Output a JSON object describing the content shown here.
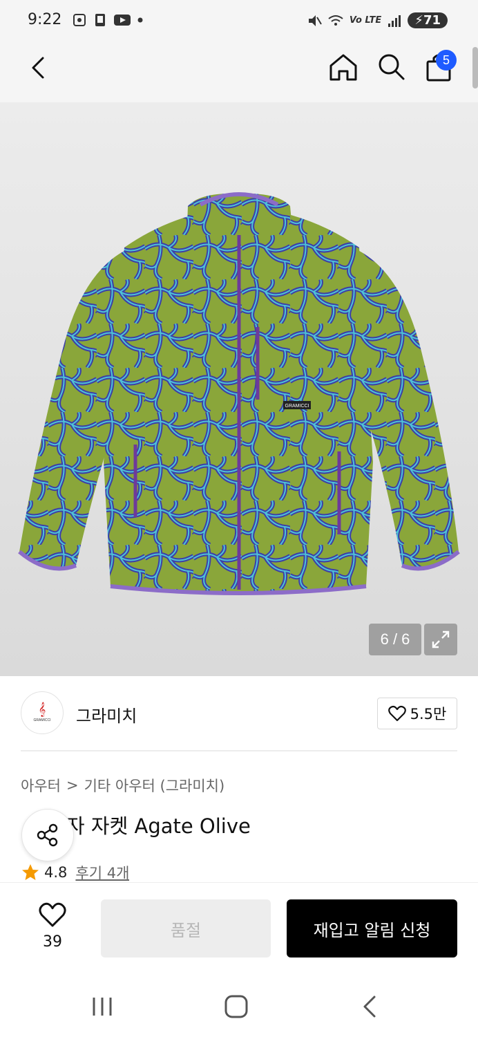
{
  "status_bar": {
    "time": "9:22",
    "lte": "Vo LTE",
    "battery": "71"
  },
  "nav": {
    "cart_count": "5"
  },
  "gallery": {
    "counter": "6 / 6",
    "jacket_tag": "GRAMICCI"
  },
  "brand": {
    "name": "그라미치",
    "likes": "5.5만",
    "logo_text": "GRAMICCI"
  },
  "breadcrumb": {
    "category": "아우터",
    "separator": ">",
    "subcategory": "기타 아우터 (그라미치)"
  },
  "product": {
    "title": "자 자켓 Agate Olive",
    "rating": "4.8",
    "review_link": "후기 4개"
  },
  "actions": {
    "wish_count": "39",
    "soldout_label": "품절",
    "restock_label": "재입고 알림 신청"
  },
  "colors": {
    "accent_blue": "#1e5bff",
    "jacket_green": "#8aa63a",
    "jacket_pattern": "#3c3fa8",
    "star": "#f59a00"
  }
}
